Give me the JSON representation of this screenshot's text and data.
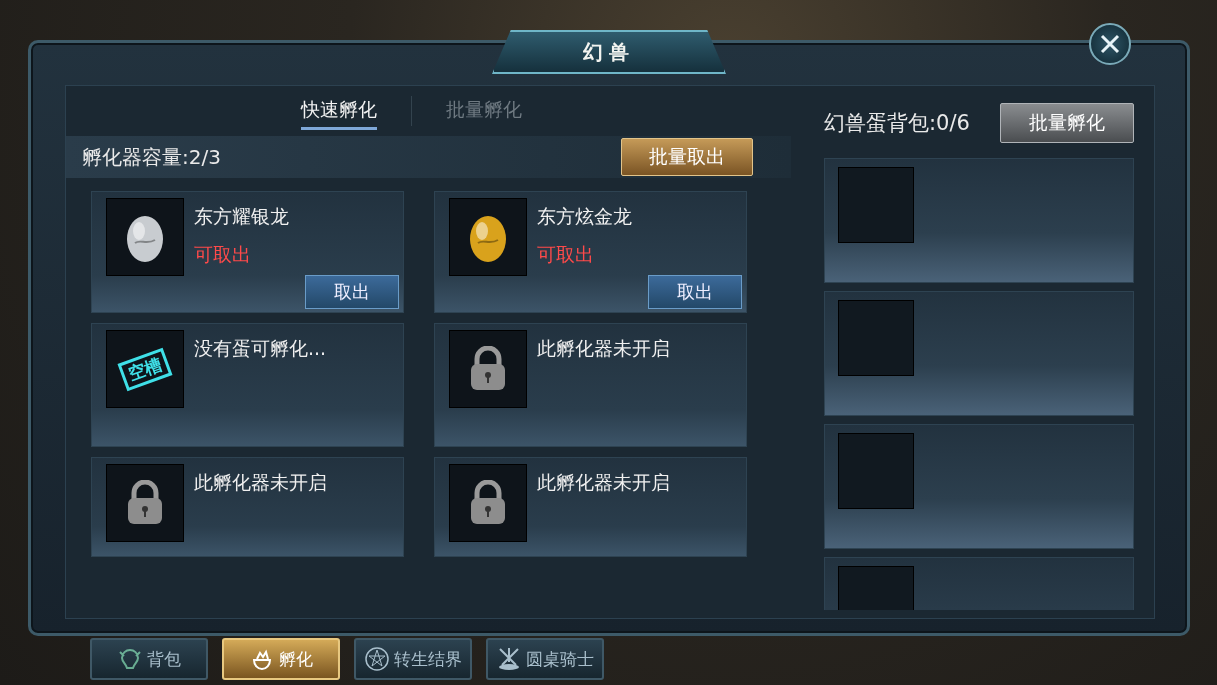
{
  "window": {
    "title": "幻兽"
  },
  "hatch_tabs": [
    {
      "label": "快速孵化",
      "selected": true
    },
    {
      "label": "批量孵化",
      "selected": false
    }
  ],
  "capacity": {
    "label": "孵化器容量:2/3",
    "button": "批量取出"
  },
  "incubators": [
    {
      "kind": "egg",
      "name": "东方耀银龙",
      "color": "#c8ccd0",
      "status": "可取出",
      "button": "取出"
    },
    {
      "kind": "egg",
      "name": "东方炫金龙",
      "color": "#d9a21c",
      "status": "可取出",
      "button": "取出"
    },
    {
      "kind": "empty",
      "name": "没有蛋可孵化...",
      "stamp": "空槽"
    },
    {
      "kind": "locked",
      "name": "此孵化器未开启"
    },
    {
      "kind": "locked",
      "name": "此孵化器未开启"
    },
    {
      "kind": "locked",
      "name": "此孵化器未开启"
    }
  ],
  "egg_bag": {
    "label": "幻兽蛋背包:0/6",
    "button": "批量孵化"
  },
  "bottom_tabs": [
    {
      "label": "背包",
      "kind": "beast",
      "selected": false
    },
    {
      "label": "孵化",
      "kind": "hatch",
      "selected": true
    },
    {
      "label": "转生结界",
      "kind": "pentagram",
      "selected": false
    },
    {
      "label": "圆桌骑士",
      "kind": "swords",
      "selected": false
    }
  ]
}
